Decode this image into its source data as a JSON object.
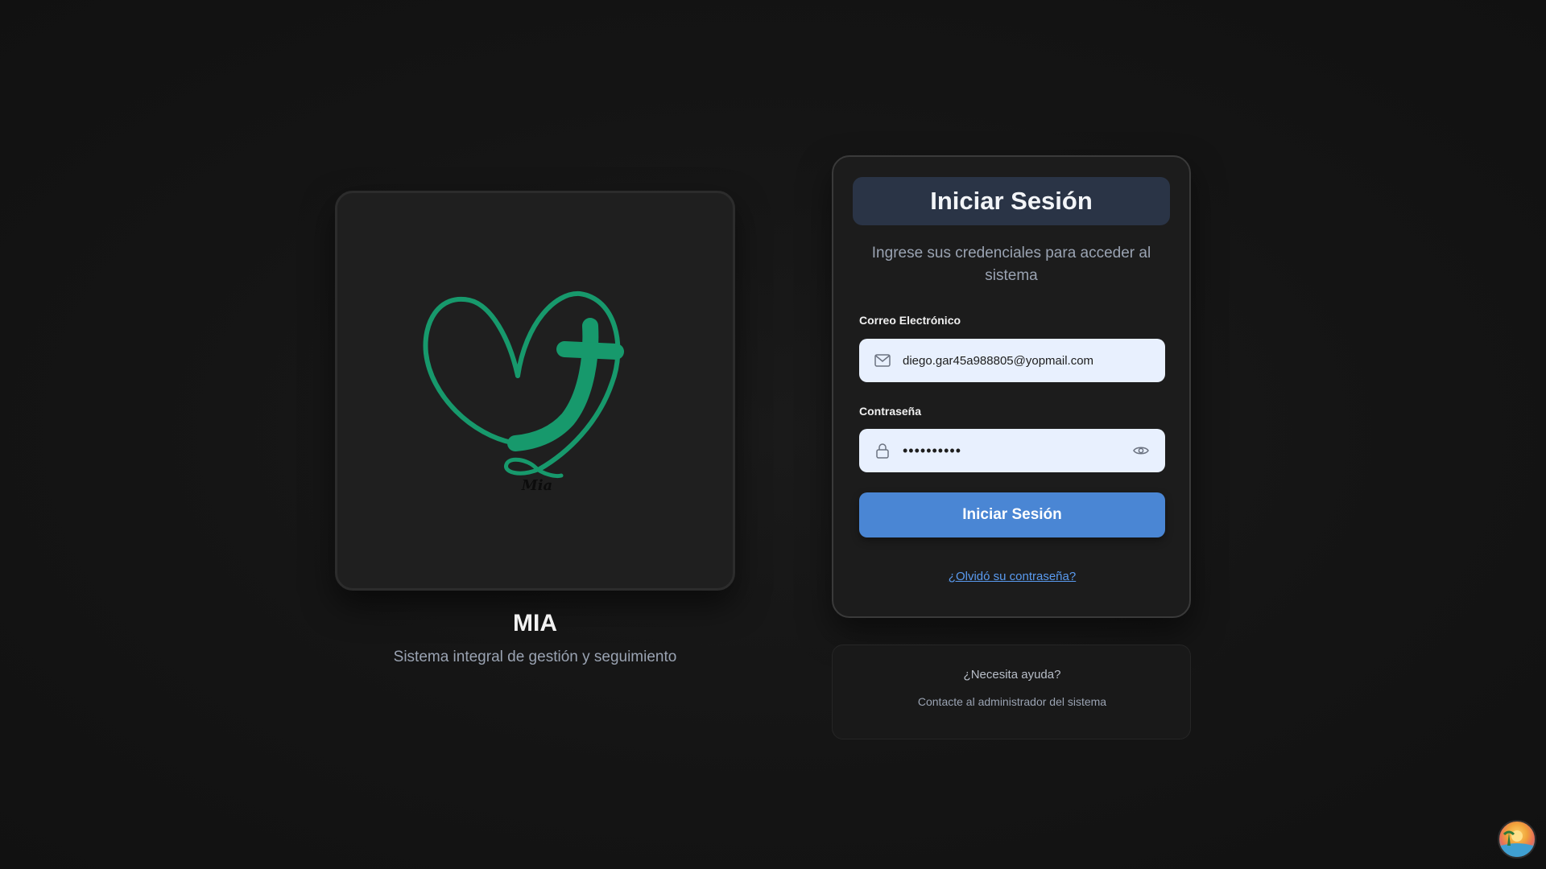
{
  "brand": {
    "logo_caption": "Mia",
    "name": "MIA",
    "subtitle": "Sistema integral de gestión y seguimiento",
    "logo_color": "#17996c"
  },
  "login": {
    "title": "Iniciar Sesión",
    "description": "Ingrese sus credenciales para acceder al sistema",
    "email_label": "Correo Electrónico",
    "email_value": "diego.gar45a988805@yopmail.com",
    "password_label": "Contraseña",
    "password_value": "••••••••••",
    "submit_label": "Iniciar Sesión",
    "forgot_label": "¿Olvidó su contraseña?",
    "accent_color": "#4a86d4"
  },
  "help": {
    "title": "¿Necesita ayuda?",
    "text": "Contacte al administrador del sistema"
  },
  "icons": {
    "email": "mail-icon",
    "password": "lock-icon",
    "toggle": "eye-icon",
    "avatar": "user-avatar"
  }
}
